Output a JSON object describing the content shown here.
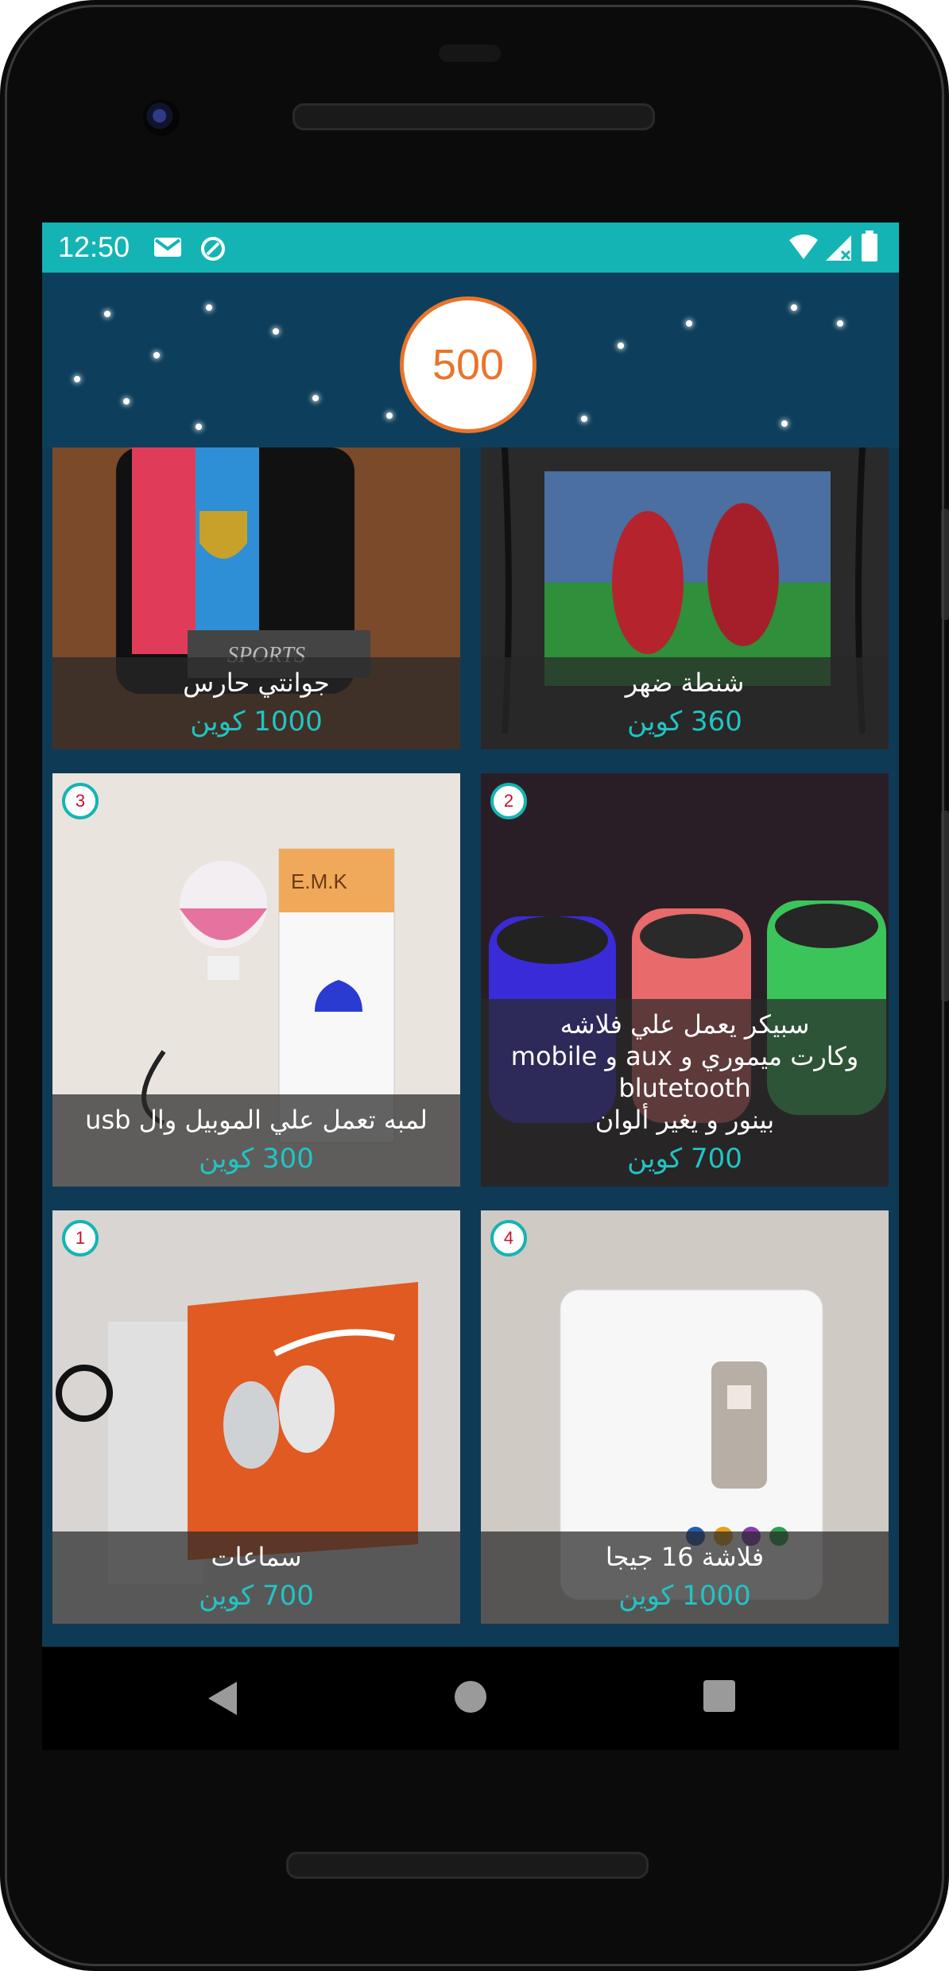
{
  "status_bar": {
    "time": "12:50",
    "left_icons": [
      "gmail-icon",
      "sync-icon"
    ],
    "right_icons": [
      "wifi-icon",
      "signal-icon",
      "battery-icon"
    ]
  },
  "header": {
    "coin_balance": "500"
  },
  "products": [
    {
      "title": "جوانتي حارس",
      "price": "1000 كوين",
      "rank": ""
    },
    {
      "title": "شنطة ضهر",
      "price": "360 كوين",
      "rank": ""
    },
    {
      "title": "لمبه تعمل علي الموبيل وال usb",
      "price": "300 كوين",
      "rank": "3"
    },
    {
      "title": "سبيكر يعمل علي فلاشه\nوكارت ميموري و aux و mobile\nblutetooth\nبينور و يغير ألوان",
      "price": "700 كوين",
      "rank": "2"
    },
    {
      "title": "سماعات",
      "price": "700 كوين",
      "rank": "1"
    },
    {
      "title": "فلاشة 16 جيجا",
      "price": "1000 كوين",
      "rank": "4"
    }
  ],
  "nav": {
    "icons": [
      "back-icon",
      "home-icon",
      "recents-icon"
    ]
  },
  "colors": {
    "accent": "#14b4b4",
    "coin_orange": "#e8752b",
    "price_teal": "#21c4c4"
  }
}
